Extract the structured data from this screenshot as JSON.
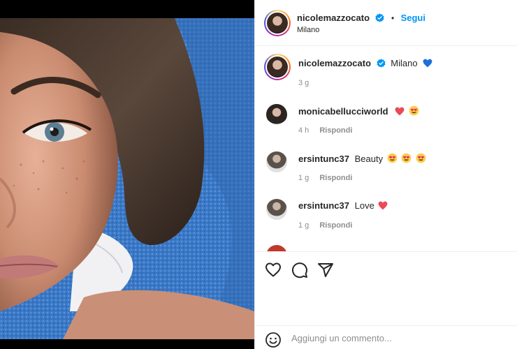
{
  "post": {
    "author": "nicolemazzocato",
    "location": "Milano",
    "follow_label": "Segui",
    "dot": "•"
  },
  "caption": {
    "username": "nicolemazzocato",
    "text": "Milano",
    "time": "3 g"
  },
  "comments": [
    {
      "username": "monicabellucciworld",
      "text": "",
      "emojis": [
        "red-heart",
        "heart-eyes"
      ],
      "time": "4 h",
      "reply_label": "Rispondi"
    },
    {
      "username": "ersintunc37",
      "text": "Beauty",
      "emojis": [
        "heart-eyes",
        "heart-eyes",
        "heart-eyes"
      ],
      "time": "1 g",
      "reply_label": "Rispondi"
    },
    {
      "username": "ersintunc37",
      "text": "Love",
      "emojis": [
        "red-heart"
      ],
      "time": "1 g",
      "reply_label": "Rispondi"
    }
  ],
  "actions": {
    "icons": [
      "heart-icon",
      "comment-icon",
      "share-icon"
    ]
  },
  "add_comment": {
    "placeholder": "Aggiungi un commento..."
  },
  "colors": {
    "accent": "#0095f6",
    "muted": "#8e8e8e",
    "heart_red": "#ed4956",
    "blue_heart": "#1e6fd9",
    "towel": "#3a78c6"
  }
}
